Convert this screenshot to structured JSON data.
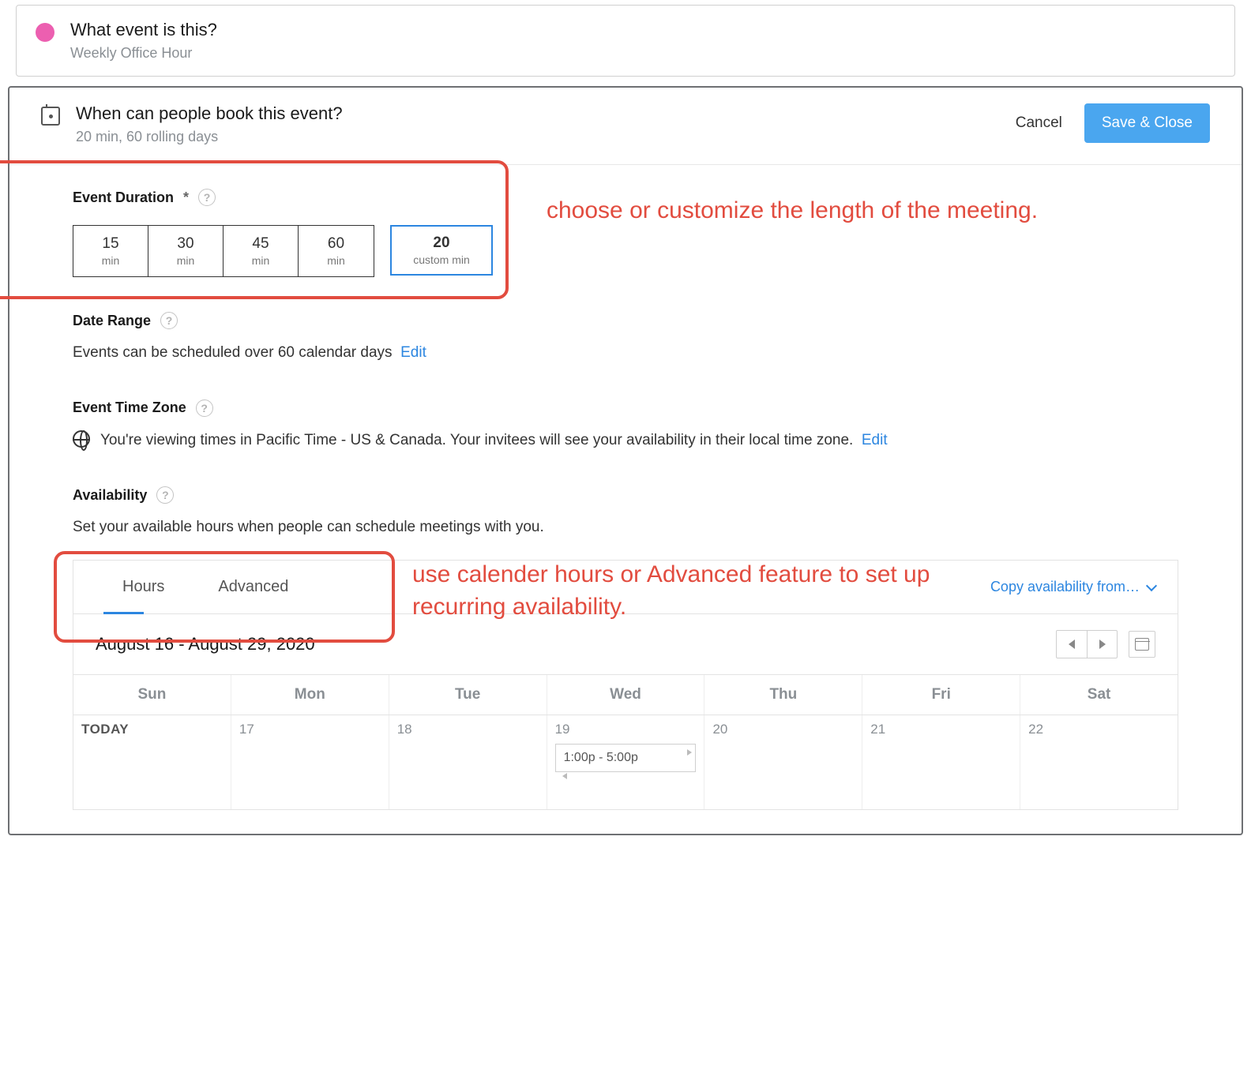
{
  "top_card": {
    "title": "What event is this?",
    "subtitle": "Weekly Office Hour"
  },
  "main_header": {
    "title": "When can people book this event?",
    "subtitle": "20 min, 60 rolling days",
    "cancel": "Cancel",
    "save": "Save & Close"
  },
  "duration": {
    "label": "Event Duration",
    "star": "*",
    "options": [
      {
        "num": "15",
        "unit": "min"
      },
      {
        "num": "30",
        "unit": "min"
      },
      {
        "num": "45",
        "unit": "min"
      },
      {
        "num": "60",
        "unit": "min"
      }
    ],
    "custom": {
      "num": "20",
      "unit": "custom min"
    }
  },
  "date_range": {
    "label": "Date Range",
    "desc": "Events can be scheduled over 60 calendar days",
    "edit": "Edit"
  },
  "timezone": {
    "label": "Event Time Zone",
    "desc": "You're viewing times in Pacific Time - US & Canada. Your invitees will see your availability in their local time zone.",
    "edit": "Edit"
  },
  "availability": {
    "label": "Availability",
    "desc": "Set your available hours when people can schedule meetings with you.",
    "tabs": {
      "hours": "Hours",
      "advanced": "Advanced"
    },
    "copy_link": "Copy availability from…",
    "range_title": "August 16 - August 29, 2020",
    "weekdays": [
      "Sun",
      "Mon",
      "Tue",
      "Wed",
      "Thu",
      "Fri",
      "Sat"
    ],
    "cells": {
      "today": "TODAY",
      "d1": "17",
      "d2": "18",
      "d3": "19",
      "d4": "20",
      "d5": "21",
      "d6": "22"
    },
    "event_block": "1:00p - 5:00p"
  },
  "annotations": {
    "a1": "choose or customize the length of the meeting.",
    "a2": "use calender hours or Advanced feature to set up recurring availability."
  }
}
